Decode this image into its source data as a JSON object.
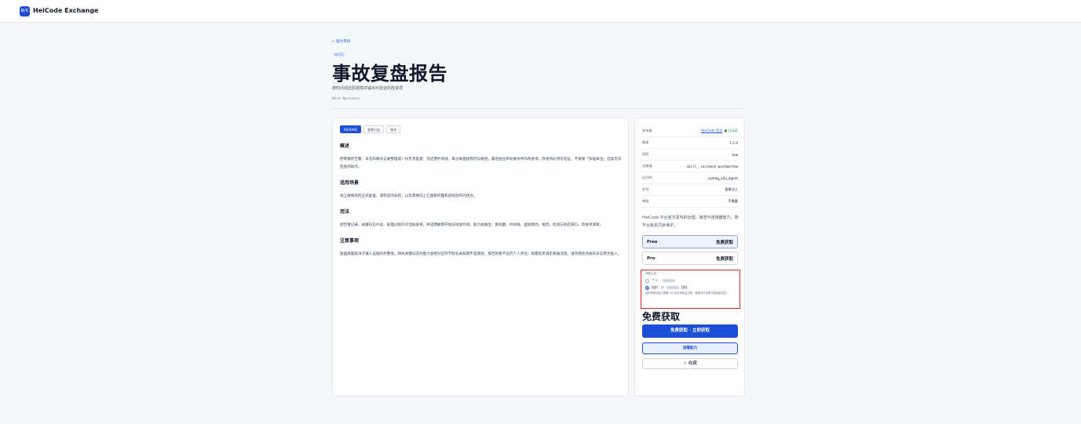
{
  "header": {
    "logo_text": "H/C",
    "brand": "HeiCode Exchange"
  },
  "breadcrumb": {
    "back": "← 能力市场"
  },
  "skill": {
    "type_tag": "skill",
    "title": "事故复盘报告",
    "subtitle": "按时间线还原故障并输出可验证的改进项",
    "hashtags": "#sre #process"
  },
  "tabs": [
    {
      "label": "README",
      "active": true
    },
    {
      "label": "变更日志",
      "active": false
    },
    {
      "label": "版本",
      "active": false
    }
  ],
  "readme": {
    "sections": [
      {
        "heading": "概述",
        "body": "把零散的告警、日志和聊天记录整理成一份无责复盘：先还原时间线，再分离直接原因与根因，最后给出带验收条件的改进项。改进项必须可验证，不接受「加强关注」这类无法检查的动作。"
      },
      {
        "heading": "适用场景",
        "body": "线上故障后的正式复盘、演练后的总结，以及需要向上汇报影响面和后续动作的场合。"
      },
      {
        "heading": "用法",
        "body": "把告警记录、关键日志片段、处理过程的对话贴进来，并说明故障开始与恢复时间。能力会输出：影响面、时间线、直接原因、根因、检测与响应缺口、改进项清单。"
      },
      {
        "heading": "注意事项",
        "body": "复盘质量取决于输入证据的完整性。缺失关键日志时能力会把对应环节标为未知而不是猜测。报告刻意不追究个人责任；如需追责请走单独流程。请勿把含凭据的日志原文贴入。"
      }
    ]
  },
  "meta": [
    {
      "label": "发布者",
      "value": "HeiCode 官方",
      "extra": "● 已认证",
      "link": true
    },
    {
      "label": "版本",
      "value": "1.2.0"
    },
    {
      "label": "风险",
      "value": "low"
    },
    {
      "label": "注册键",
      "value": "skill__incident-postmortem",
      "mono": true
    },
    {
      "label": "运行时",
      "value": "coding_a2a_agent"
    },
    {
      "label": "交付",
      "value": "直接注入"
    },
    {
      "label": "审批",
      "value": "不需要"
    }
  ],
  "description": "HeiCode 平台官方发布的治理、审查与连接器能力，随平台版本同步维护。",
  "plans": [
    {
      "name": "Free",
      "price": "免费获取",
      "selected": true
    },
    {
      "name": "Pro",
      "price": "免费获取",
      "selected": false
    }
  ],
  "acquire_as": {
    "title": "获取主体",
    "options": [
      {
        "label": "个人 ·",
        "checked": false
      },
      {
        "label": "组织 · 小",
        "suffix": "团队",
        "checked": true
      }
    ],
    "note": "组织获取的能力需要 VM 安全审查后分配，管理员可设置分配给各成员。"
  },
  "price_display": "免费获取",
  "buttons": {
    "primary": "免费获取 · 立即获取",
    "deploy": "部署能力",
    "favorite": "☆ 收藏"
  }
}
